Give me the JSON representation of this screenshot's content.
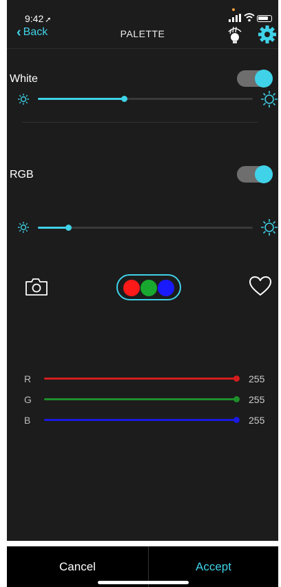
{
  "status": {
    "time": "9:42",
    "location_icon": "location-arrow-icon"
  },
  "nav": {
    "back_label": "Back",
    "title": "PALETTE"
  },
  "white": {
    "label": "White",
    "on": true,
    "brightness_fraction": 0.4
  },
  "rgb": {
    "label": "RGB",
    "on": true,
    "brightness_fraction": 0.14
  },
  "swatch": {
    "colors": [
      "#ff1a1a",
      "#18a830",
      "#1a1aff"
    ]
  },
  "channels": [
    {
      "label": "R",
      "value": "255",
      "color": "#d51c1c"
    },
    {
      "label": "G",
      "value": "255",
      "color": "#1d8f2a"
    },
    {
      "label": "B",
      "value": "255",
      "color": "#1a1ae0"
    }
  ],
  "footer": {
    "cancel_label": "Cancel",
    "accept_label": "Accept"
  },
  "colors": {
    "accent": "#3fd2e8",
    "background": "#1c1c1c"
  }
}
